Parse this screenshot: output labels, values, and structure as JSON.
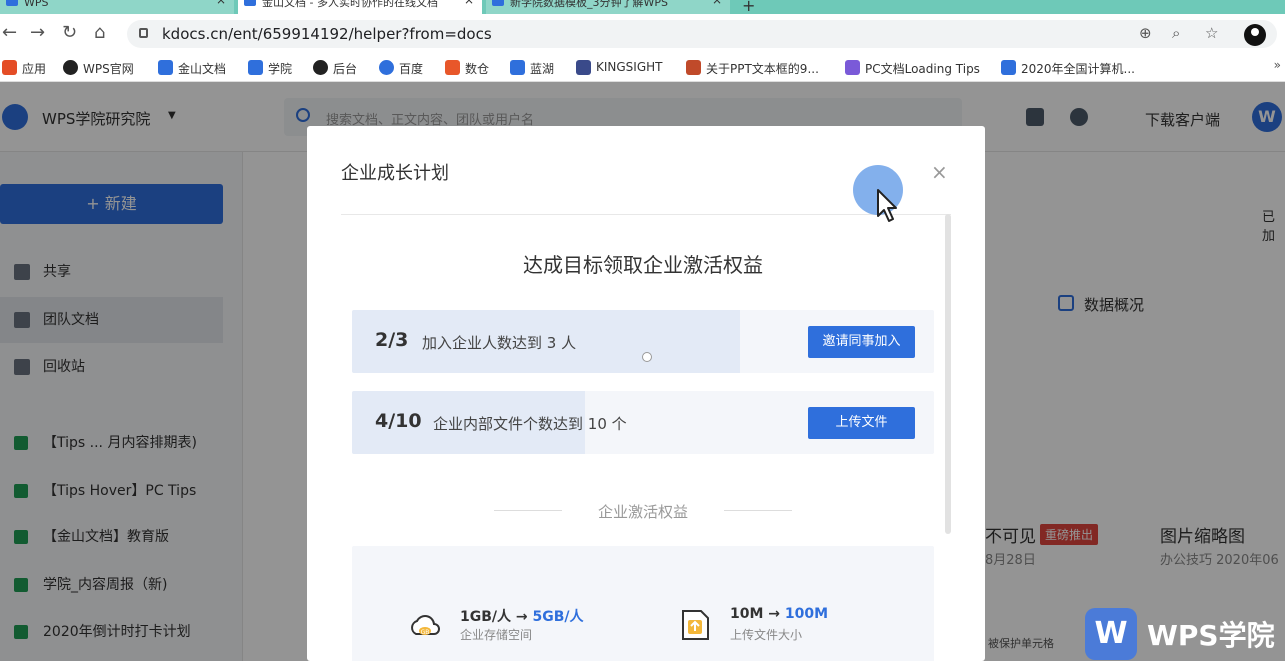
{
  "browser": {
    "tabs": [
      {
        "label": "WPS",
        "active": false
      },
      {
        "label": "金山文档 - 多人实时协作的在线文档",
        "active": true
      },
      {
        "label": "新学院数据模板_3分钟了解WPS",
        "active": false
      }
    ],
    "url": "kdocs.cn/ent/659914192/helper?from=docs",
    "bookmarks": [
      {
        "label": "应用",
        "color": "#e44d26"
      },
      {
        "label": "WPS官网",
        "color": "#222222"
      },
      {
        "label": "金山文档",
        "color": "#2f6fdc"
      },
      {
        "label": "学院",
        "color": "#2f6fdc"
      },
      {
        "label": "后台",
        "color": "#222222"
      },
      {
        "label": "百度",
        "color": "#2f6fdc"
      },
      {
        "label": "数仓",
        "color": "#e8572a"
      },
      {
        "label": "蓝湖",
        "color": "#2f6fdc"
      },
      {
        "label": "KINGSIGHT",
        "color": "#3a4a8a"
      },
      {
        "label": "关于PPT文本框的9...",
        "color": "#c04a2a"
      },
      {
        "label": "PC文档Loading Tips",
        "color": "#7a5ad8"
      },
      {
        "label": "2020年全国计算机...",
        "color": "#2f6fdc"
      }
    ],
    "bookmarks_more": "»"
  },
  "app": {
    "workspace_name": "WPS学院研究院",
    "search_placeholder": "搜索文档、正文内容、团队或用户名",
    "download_label": "下载客户端",
    "new_button": "+ 新建",
    "nav": [
      {
        "label": "共享",
        "selected": false
      },
      {
        "label": "团队文档",
        "selected": true
      },
      {
        "label": "回收站",
        "selected": false
      }
    ],
    "files": [
      "【Tips ... 月内容排期表)",
      "【Tips Hover】PC Tips",
      "【金山文档】教育版",
      "学院_内容周报（新)",
      "2020年倒计时打卡计划"
    ],
    "data_overview_tab": "数据概况",
    "already_label": "已加",
    "card1_title": "不可见",
    "card1_badge": "重磅推出",
    "card1_meta": "8月28日",
    "card2_title": "图片缩略图",
    "card2_meta": "办公技巧  2020年06",
    "card1_thumb_label": "被保护单元格"
  },
  "modal": {
    "title": "企业成长计划",
    "close_icon": "×",
    "heading": "达成目标领取企业激活权益",
    "tasks": [
      {
        "count": "2/3",
        "desc": "加入企业人数达到 3 人",
        "button": "邀请同事加入",
        "progress": 0.667
      },
      {
        "count": "4/10",
        "desc": "企业内部文件个数达到 10 个",
        "button": "上传文件",
        "progress": 0.4
      }
    ],
    "benefits_label": "企业激活权益",
    "benefits": [
      {
        "from": "1GB/人 → ",
        "to": "5GB/人",
        "caption": "企业存储空间",
        "icon": "cloud-gb-icon"
      },
      {
        "from": "10M → ",
        "to": "100M",
        "caption": "上传文件大小",
        "icon": "upload-file-icon"
      }
    ]
  },
  "watermark": {
    "logo": "W",
    "text": "WPS学院"
  },
  "colors": {
    "accent": "#2f6fdc",
    "tabstrip": "#6ec9b8",
    "badge": "#e0463e"
  }
}
